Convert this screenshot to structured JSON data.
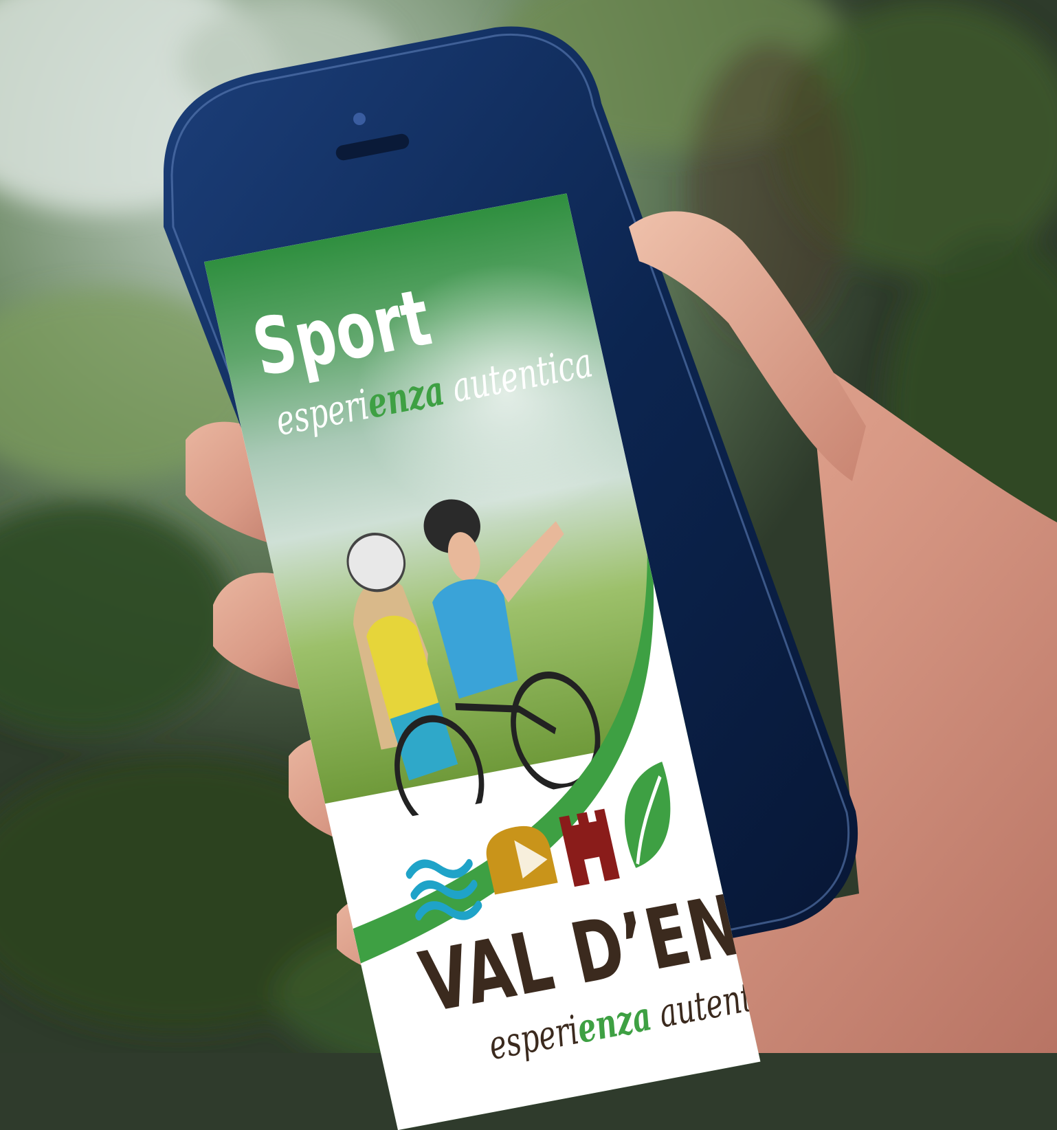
{
  "screen": {
    "title": "Sport",
    "tagline_prefix": "esperi",
    "tagline_highlight": "enza",
    "tagline_suffix": " autentica"
  },
  "logo": {
    "brand": "VAL D’ENZA",
    "tagline_prefix": "esperi",
    "tagline_highlight": "enza",
    "tagline_suffix": " autentica",
    "icons": [
      "waves-icon",
      "cheese-icon",
      "castle-tower-icon",
      "leaf-icon"
    ]
  },
  "colors": {
    "brand_green": "#3ea043",
    "brand_brown": "#3b2a1e",
    "castle_red": "#8a1c1a",
    "cheese_gold": "#c9941a",
    "water_blue": "#1fa3c8",
    "phone_body": "#0e2a55"
  },
  "phone": {
    "home_button_icon": "home-button-icon"
  }
}
